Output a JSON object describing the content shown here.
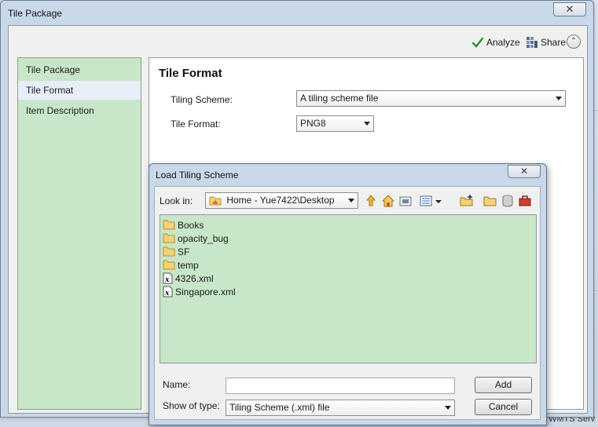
{
  "window": {
    "title": "Tile Package",
    "close_glyph": "✕",
    "toolbar": {
      "analyze_label": "Analyze",
      "share_label": "Share",
      "collapse_glyph": "⌃"
    }
  },
  "nav": {
    "items": [
      {
        "label": "Tile Package",
        "selected": false
      },
      {
        "label": "Tile Format",
        "selected": true
      },
      {
        "label": "Item Description",
        "selected": false
      }
    ]
  },
  "content": {
    "heading": "Tile Format",
    "tiling_scheme": {
      "label": "Tiling Scheme:",
      "value": "A tiling scheme file"
    },
    "tile_format": {
      "label": "Tile Format:",
      "value": "PNG8"
    }
  },
  "dialog": {
    "title": "Load Tiling Scheme",
    "close_glyph": "✕",
    "look_in": {
      "label": "Look in:",
      "value": "Home - Yue7422\\Desktop"
    },
    "files": [
      {
        "name": "Books",
        "type": "folder"
      },
      {
        "name": "opacity_bug",
        "type": "folder"
      },
      {
        "name": "SF",
        "type": "folder"
      },
      {
        "name": "temp",
        "type": "folder"
      },
      {
        "name": "4326.xml",
        "type": "xml"
      },
      {
        "name": "Singapore.xml",
        "type": "xml"
      }
    ],
    "name_field": {
      "label": "Name:",
      "value": ""
    },
    "type_field": {
      "label": "Show of type:",
      "value": "Tiling Scheme (.xml) file"
    },
    "buttons": {
      "add": "Add",
      "cancel": "Cancel"
    }
  },
  "background": {
    "partial_text": "WMTS Serv"
  },
  "colors": {
    "panel_green": "#c8e6c8",
    "window_frame": "#c9d8e9"
  }
}
